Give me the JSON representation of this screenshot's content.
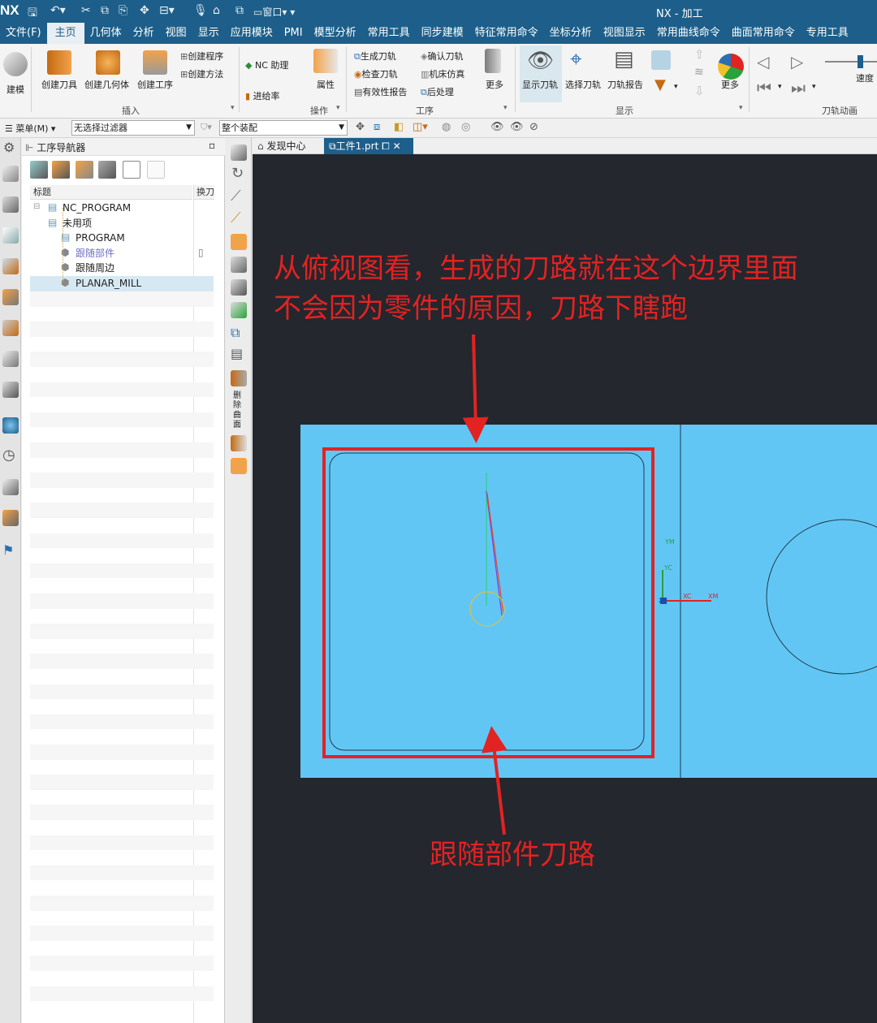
{
  "titlebar": {
    "logo": "NX",
    "window_menu": "窗口",
    "title": "NX - 加工"
  },
  "menubar": {
    "items": [
      "文件(F)",
      "主页",
      "几何体",
      "分析",
      "视图",
      "显示",
      "应用模块",
      "PMI",
      "模型分析",
      "常用工具",
      "同步建模",
      "特征常用命令",
      "坐标分析",
      "视图显示",
      "常用曲线命令",
      "曲面常用命令",
      "专用工具"
    ],
    "active": "主页"
  },
  "ribbon": {
    "model_label": "建模",
    "create_tool": "创建刀具",
    "create_geometry": "创建几何体",
    "create_operation": "创建工序",
    "create_program": "创建程序",
    "create_method": "创建方法",
    "nc_assistant": "NC 助理",
    "feed_rate": "进给率",
    "properties": "属性",
    "generate_toolpath": "生成刀轨",
    "verify_toolpath": "确认刀轨",
    "check_toolpath": "检查刀轨",
    "machine_sim": "机床仿真",
    "validity_report": "有效性报告",
    "postprocess": "后处理",
    "more_ops": "更多",
    "show_toolpath": "显示刀轨",
    "select_toolpath": "选择刀轨",
    "toolpath_report": "刀轨报告",
    "more_display": "更多",
    "speed": "速度",
    "group_insert": "插入",
    "group_operations": "操作",
    "group_process": "工序",
    "group_display": "显示",
    "group_animation": "刀轨动画"
  },
  "filterbar": {
    "menu": "菜单(M)",
    "filter": "无选择过滤器",
    "assembly": "整个装配"
  },
  "navigator": {
    "title": "工序导航器",
    "col_name": "标题",
    "col_tool": "换刀",
    "rows": [
      {
        "label": "NC_PROGRAM",
        "indent": 0
      },
      {
        "label": "未用项",
        "indent": 1
      },
      {
        "label": "PROGRAM",
        "indent": 2
      },
      {
        "label": "跟随部件",
        "indent": 2
      },
      {
        "label": "跟随周边",
        "indent": 2
      },
      {
        "label": "PLANAR_MILL",
        "indent": 2
      }
    ]
  },
  "vstrip": {
    "vertical_label": "删除曲面"
  },
  "tabs": {
    "discovery": "发现中心",
    "part": "工件1.prt"
  },
  "viewport": {
    "annotation_line1": "从俯视图看，生成的刀路就在这个边界里面",
    "annotation_line2": "不会因为零件的原因，刀路下瞎跑",
    "annotation_bottom": "跟随部件刀路",
    "axis_ym": "YM",
    "axis_yc": "YC",
    "axis_xc": "XC",
    "axis_xm": "XM",
    "axis_zm": "ZM"
  },
  "colors": {
    "titlebar": "#1d5f8a",
    "viewport_bg": "#24272d",
    "part_fill": "#62c6f5",
    "annotation_red": "#e32222"
  }
}
